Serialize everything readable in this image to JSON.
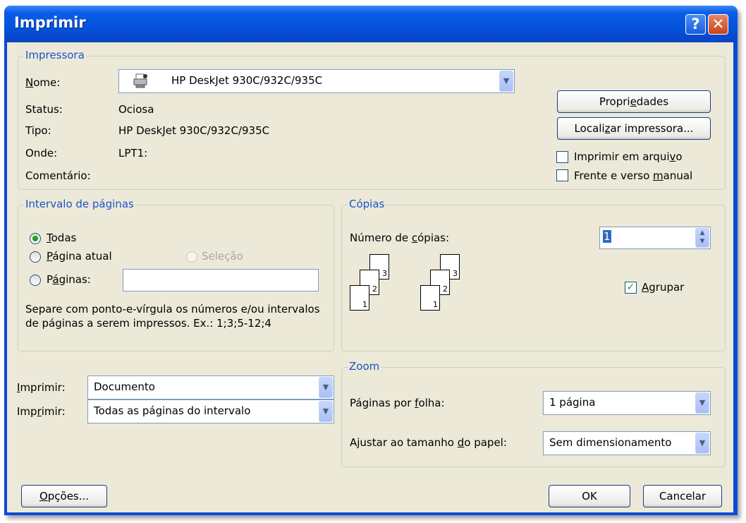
{
  "window": {
    "title": "Imprimir",
    "help_glyph": "?",
    "close_glyph": "✕"
  },
  "printer": {
    "legend": "Impressora",
    "name_label": "Nome:",
    "name_value": "HP DeskJet 930C/932C/935C",
    "status_label": "Status:",
    "status_value": "Ociosa",
    "type_label": "Tipo:",
    "type_value": "HP DeskJet 930C/932C/935C",
    "where_label": "Onde:",
    "where_value": "LPT1:",
    "comment_label": "Comentário:",
    "comment_value": "",
    "properties_button": "Propriedades",
    "find_printer_button": "Localizar impressora...",
    "print_to_file_label": "Imprimir em arquivo",
    "print_to_file_checked": false,
    "manual_duplex_label": "Frente e verso manual",
    "manual_duplex_checked": false
  },
  "page_range": {
    "legend": "Intervalo de páginas",
    "all_label": "Todas",
    "current_label": "Página atual",
    "selection_label": "Seleção",
    "pages_label": "Páginas:",
    "pages_value": "",
    "selected": "Todas",
    "hint": "Separe com ponto-e-vírgula os números e/ou intervalos de páginas a serem impressos. Ex.: 1;3;5-12;4"
  },
  "copies": {
    "legend": "Cópias",
    "number_label": "Número de cópias:",
    "number_value": "1",
    "collate_label": "Agrupar",
    "collate_checked": true,
    "collated_icon_pages": [
      "3",
      "2",
      "1"
    ],
    "uncollated_icon_pages": [
      "3",
      "2",
      "1"
    ]
  },
  "print_what": {
    "label1": "Imprimir:",
    "value1": "Documento",
    "label2": "Imprimir:",
    "value2": "Todas as páginas do intervalo"
  },
  "zoom": {
    "legend": "Zoom",
    "pages_per_sheet_label": "Páginas por folha:",
    "pages_per_sheet_value": "1 página",
    "scale_label": "Ajustar ao tamanho do papel:",
    "scale_value": "Sem dimensionamento"
  },
  "footer": {
    "options_button": "Opções...",
    "ok_button": "OK",
    "cancel_button": "Cancelar"
  },
  "colors": {
    "title_bar": "#0a5ce8",
    "dialog_bg": "#ece9d8",
    "legend_text": "#1a52c8",
    "close_button": "#c8431c"
  }
}
